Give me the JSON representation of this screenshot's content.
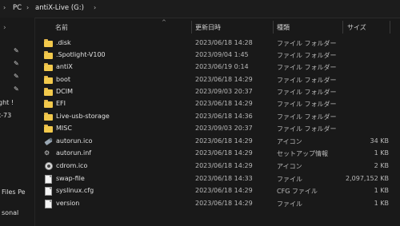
{
  "address_bar": {
    "crumbs": [
      "PC",
      "antiX-Live (G:)"
    ]
  },
  "nav_pane": {
    "labels": [
      "ght !",
      "t-73",
      "Files Pe",
      "sonal"
    ]
  },
  "columns": {
    "name": "名前",
    "date": "更新日時",
    "type": "種類",
    "size": "サイズ"
  },
  "files": [
    {
      "name": ".disk",
      "date": "2023/06/18 14:28",
      "type": "ファイル フォルダー",
      "size": "",
      "icon": "folder-icon"
    },
    {
      "name": ".Spotlight-V100",
      "date": "2023/09/04 1:45",
      "type": "ファイル フォルダー",
      "size": "",
      "icon": "folder-icon"
    },
    {
      "name": "antiX",
      "date": "2023/06/19 0:14",
      "type": "ファイル フォルダー",
      "size": "",
      "icon": "folder-icon"
    },
    {
      "name": "boot",
      "date": "2023/06/18 14:29",
      "type": "ファイル フォルダー",
      "size": "",
      "icon": "folder-icon"
    },
    {
      "name": "DCIM",
      "date": "2023/09/03 20:37",
      "type": "ファイル フォルダー",
      "size": "",
      "icon": "folder-icon"
    },
    {
      "name": "EFI",
      "date": "2023/06/18 14:29",
      "type": "ファイル フォルダー",
      "size": "",
      "icon": "folder-icon"
    },
    {
      "name": "Live-usb-storage",
      "date": "2023/06/18 14:36",
      "type": "ファイル フォルダー",
      "size": "",
      "icon": "folder-icon"
    },
    {
      "name": "MISC",
      "date": "2023/09/03 20:37",
      "type": "ファイル フォルダー",
      "size": "",
      "icon": "folder-icon"
    },
    {
      "name": "autorun.ico",
      "date": "2023/06/18 14:29",
      "type": "アイコン",
      "size": "34 KB",
      "icon": "usb-drive-icon"
    },
    {
      "name": "autorun.inf",
      "date": "2023/06/18 14:29",
      "type": "セットアップ情報",
      "size": "1 KB",
      "icon": "settings-file-icon"
    },
    {
      "name": "cdrom.ico",
      "date": "2023/06/18 14:29",
      "type": "アイコン",
      "size": "2 KB",
      "icon": "disc-icon"
    },
    {
      "name": "swap-file",
      "date": "2023/06/18 14:33",
      "type": "ファイル",
      "size": "2,097,152 KB",
      "icon": "file-icon"
    },
    {
      "name": "syslinux.cfg",
      "date": "2023/06/18 14:29",
      "type": "CFG ファイル",
      "size": "1 KB",
      "icon": "file-icon"
    },
    {
      "name": "version",
      "date": "2023/06/18 14:29",
      "type": "ファイル",
      "size": "1 KB",
      "icon": "file-icon"
    }
  ]
}
